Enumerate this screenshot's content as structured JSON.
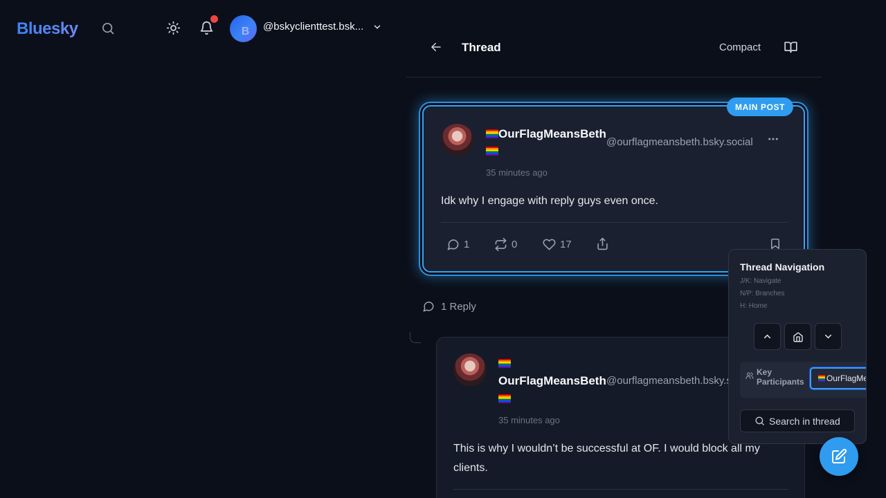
{
  "app": {
    "logo": "Bluesky"
  },
  "account": {
    "avatar_letter": "B",
    "handle": "@bskyclienttest.bsk..."
  },
  "thread": {
    "title": "Thread",
    "compact_label": "Compact"
  },
  "main_post": {
    "badge": "MAIN POST",
    "display_name": "OurFlagMeansBeth",
    "handle": "@ourflagmeansbeth.bsky.social",
    "time": "35 minutes ago",
    "text": "Idk why I engage with reply guys even once.",
    "reply_count": "1",
    "repost_count": "0",
    "like_count": "17"
  },
  "replies_label": "1 Reply",
  "reply": {
    "display_name": "OurFlagMeansBeth",
    "handle": "@ourflagmeansbeth.bsky.s",
    "time": "35 minutes ago",
    "text": "This is why I wouldn’t be successful at OF. I would block all my clients."
  },
  "nav_panel": {
    "title": "Thread Navigation",
    "hints": [
      "J/K: Navigate",
      "N/P: Branches",
      "H: Home"
    ],
    "participants_label": "Key Participants",
    "participant_chip": "OurFlagMeansBeth",
    "search_label": "Search in thread"
  },
  "icons": {
    "search": "search-icon",
    "theme": "sun-icon",
    "notifications": "bell-icon",
    "back": "arrow-left-icon",
    "reader": "book-open-icon",
    "more": "more-horizontal-icon",
    "reply": "message-circle-icon",
    "repost": "repeat-icon",
    "like": "heart-icon",
    "share": "share-icon",
    "bookmark": "bookmark-icon",
    "compose": "edit-icon"
  },
  "colors": {
    "accent": "#2f9cf0",
    "background": "#0b0f1a",
    "notification": "#ef4444"
  }
}
